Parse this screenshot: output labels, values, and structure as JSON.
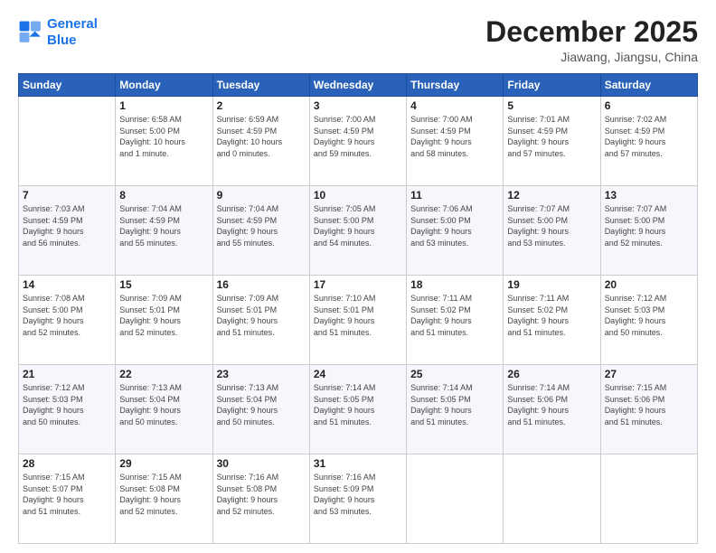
{
  "header": {
    "logo_line1": "General",
    "logo_line2": "Blue",
    "month_title": "December 2025",
    "location": "Jiawang, Jiangsu, China"
  },
  "days_of_week": [
    "Sunday",
    "Monday",
    "Tuesday",
    "Wednesday",
    "Thursday",
    "Friday",
    "Saturday"
  ],
  "weeks": [
    [
      {
        "day": "",
        "info": ""
      },
      {
        "day": "1",
        "info": "Sunrise: 6:58 AM\nSunset: 5:00 PM\nDaylight: 10 hours\nand 1 minute."
      },
      {
        "day": "2",
        "info": "Sunrise: 6:59 AM\nSunset: 4:59 PM\nDaylight: 10 hours\nand 0 minutes."
      },
      {
        "day": "3",
        "info": "Sunrise: 7:00 AM\nSunset: 4:59 PM\nDaylight: 9 hours\nand 59 minutes."
      },
      {
        "day": "4",
        "info": "Sunrise: 7:00 AM\nSunset: 4:59 PM\nDaylight: 9 hours\nand 58 minutes."
      },
      {
        "day": "5",
        "info": "Sunrise: 7:01 AM\nSunset: 4:59 PM\nDaylight: 9 hours\nand 57 minutes."
      },
      {
        "day": "6",
        "info": "Sunrise: 7:02 AM\nSunset: 4:59 PM\nDaylight: 9 hours\nand 57 minutes."
      }
    ],
    [
      {
        "day": "7",
        "info": "Sunrise: 7:03 AM\nSunset: 4:59 PM\nDaylight: 9 hours\nand 56 minutes."
      },
      {
        "day": "8",
        "info": "Sunrise: 7:04 AM\nSunset: 4:59 PM\nDaylight: 9 hours\nand 55 minutes."
      },
      {
        "day": "9",
        "info": "Sunrise: 7:04 AM\nSunset: 4:59 PM\nDaylight: 9 hours\nand 55 minutes."
      },
      {
        "day": "10",
        "info": "Sunrise: 7:05 AM\nSunset: 5:00 PM\nDaylight: 9 hours\nand 54 minutes."
      },
      {
        "day": "11",
        "info": "Sunrise: 7:06 AM\nSunset: 5:00 PM\nDaylight: 9 hours\nand 53 minutes."
      },
      {
        "day": "12",
        "info": "Sunrise: 7:07 AM\nSunset: 5:00 PM\nDaylight: 9 hours\nand 53 minutes."
      },
      {
        "day": "13",
        "info": "Sunrise: 7:07 AM\nSunset: 5:00 PM\nDaylight: 9 hours\nand 52 minutes."
      }
    ],
    [
      {
        "day": "14",
        "info": "Sunrise: 7:08 AM\nSunset: 5:00 PM\nDaylight: 9 hours\nand 52 minutes."
      },
      {
        "day": "15",
        "info": "Sunrise: 7:09 AM\nSunset: 5:01 PM\nDaylight: 9 hours\nand 52 minutes."
      },
      {
        "day": "16",
        "info": "Sunrise: 7:09 AM\nSunset: 5:01 PM\nDaylight: 9 hours\nand 51 minutes."
      },
      {
        "day": "17",
        "info": "Sunrise: 7:10 AM\nSunset: 5:01 PM\nDaylight: 9 hours\nand 51 minutes."
      },
      {
        "day": "18",
        "info": "Sunrise: 7:11 AM\nSunset: 5:02 PM\nDaylight: 9 hours\nand 51 minutes."
      },
      {
        "day": "19",
        "info": "Sunrise: 7:11 AM\nSunset: 5:02 PM\nDaylight: 9 hours\nand 51 minutes."
      },
      {
        "day": "20",
        "info": "Sunrise: 7:12 AM\nSunset: 5:03 PM\nDaylight: 9 hours\nand 50 minutes."
      }
    ],
    [
      {
        "day": "21",
        "info": "Sunrise: 7:12 AM\nSunset: 5:03 PM\nDaylight: 9 hours\nand 50 minutes."
      },
      {
        "day": "22",
        "info": "Sunrise: 7:13 AM\nSunset: 5:04 PM\nDaylight: 9 hours\nand 50 minutes."
      },
      {
        "day": "23",
        "info": "Sunrise: 7:13 AM\nSunset: 5:04 PM\nDaylight: 9 hours\nand 50 minutes."
      },
      {
        "day": "24",
        "info": "Sunrise: 7:14 AM\nSunset: 5:05 PM\nDaylight: 9 hours\nand 51 minutes."
      },
      {
        "day": "25",
        "info": "Sunrise: 7:14 AM\nSunset: 5:05 PM\nDaylight: 9 hours\nand 51 minutes."
      },
      {
        "day": "26",
        "info": "Sunrise: 7:14 AM\nSunset: 5:06 PM\nDaylight: 9 hours\nand 51 minutes."
      },
      {
        "day": "27",
        "info": "Sunrise: 7:15 AM\nSunset: 5:06 PM\nDaylight: 9 hours\nand 51 minutes."
      }
    ],
    [
      {
        "day": "28",
        "info": "Sunrise: 7:15 AM\nSunset: 5:07 PM\nDaylight: 9 hours\nand 51 minutes."
      },
      {
        "day": "29",
        "info": "Sunrise: 7:15 AM\nSunset: 5:08 PM\nDaylight: 9 hours\nand 52 minutes."
      },
      {
        "day": "30",
        "info": "Sunrise: 7:16 AM\nSunset: 5:08 PM\nDaylight: 9 hours\nand 52 minutes."
      },
      {
        "day": "31",
        "info": "Sunrise: 7:16 AM\nSunset: 5:09 PM\nDaylight: 9 hours\nand 53 minutes."
      },
      {
        "day": "",
        "info": ""
      },
      {
        "day": "",
        "info": ""
      },
      {
        "day": "",
        "info": ""
      }
    ]
  ]
}
